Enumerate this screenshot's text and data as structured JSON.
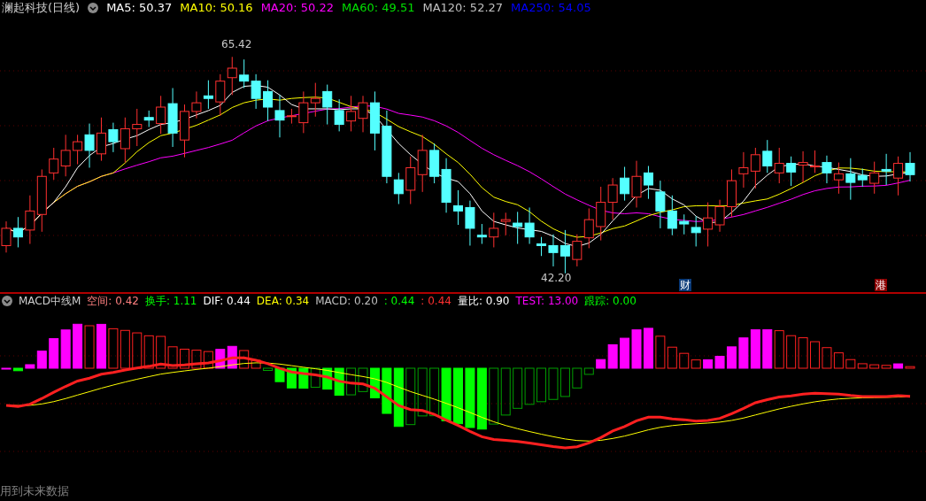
{
  "main_header": {
    "title": "澜起科技(日线)",
    "indicators": [
      {
        "text": "MA5: 50.37",
        "color": "#ffffff"
      },
      {
        "text": "MA10: 50.16",
        "color": "#ffff00"
      },
      {
        "text": "MA20: 50.22",
        "color": "#ff00ff"
      },
      {
        "text": "MA60: 49.51",
        "color": "#00e000"
      },
      {
        "text": "MA120: 52.27",
        "color": "#c0c0c0"
      },
      {
        "text": "MA250: 54.05",
        "color": "#0000ff"
      }
    ]
  },
  "price_labels": [
    {
      "text": "65.42",
      "kind": "high"
    },
    {
      "text": "42.20",
      "kind": "low"
    }
  ],
  "event_badges": [
    {
      "text": "财",
      "color": "#0a3a78"
    },
    {
      "text": "港",
      "color": "#8b0000"
    }
  ],
  "macd_header": {
    "title": "MACD中线M",
    "indicators": [
      {
        "text": "空间: 0.42",
        "color": "#ff8080"
      },
      {
        "text": "换手: 1.11",
        "color": "#00ff00"
      },
      {
        "text": "DIF: 0.44",
        "color": "#ffffff"
      },
      {
        "text": "DEA: 0.34",
        "color": "#ffff00"
      },
      {
        "text": "MACD: 0.20",
        "color": "#c0c0c0"
      },
      {
        "text": ": 0.44",
        "color": "#00ff00"
      },
      {
        "text": ": 0.44",
        "color": "#ff3030"
      },
      {
        "text": "量比: 0.90",
        "color": "#ffffff"
      },
      {
        "text": "TEST: 13.00",
        "color": "#ff00ff"
      },
      {
        "text": "跟踪: 0.00",
        "color": "#00ff00"
      }
    ]
  },
  "footer_note": "用到未来数据"
}
